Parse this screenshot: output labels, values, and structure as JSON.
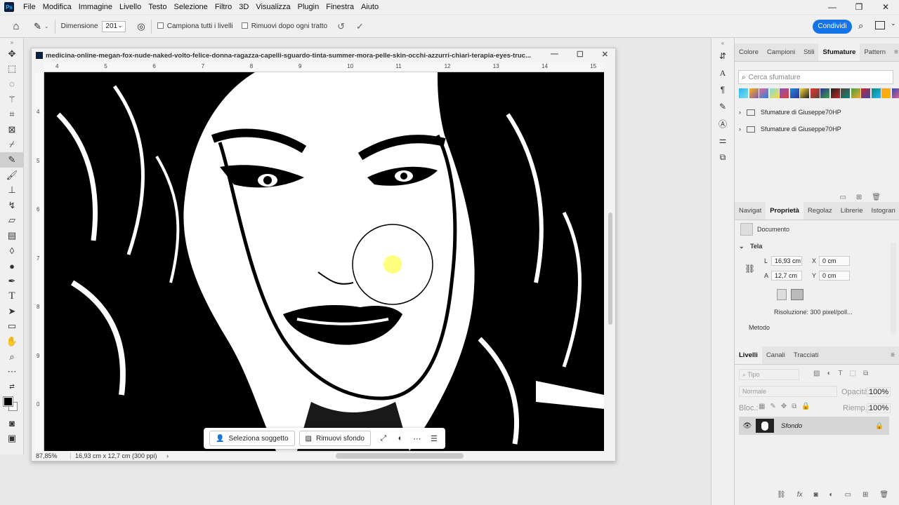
{
  "app": {
    "menu": [
      "File",
      "Modifica",
      "Immagine",
      "Livello",
      "Testo",
      "Selezione",
      "Filtro",
      "3D",
      "Visualizza",
      "Plugin",
      "Finestra",
      "Aiuto"
    ],
    "logo": "Ps",
    "window_controls": [
      "—",
      "❐",
      "✕"
    ]
  },
  "options_bar": {
    "size_label": "Dimensione",
    "size_value": "201",
    "sample_all_layers": "Campiona tutti i livelli",
    "remove_after_stroke": "Rimuovi dopo ogni tratto",
    "share_label": "Condividi"
  },
  "document": {
    "title": "medicina-online-megan-fox-nude-naked-volto-felice-donna-ragazza-capelli-sguardo-tinta-summer-mora-pelle-skin-occhi-azzurri-chiari-terapia-eyes-truc...",
    "ruler_top": [
      "4",
      "5",
      "6",
      "7",
      "8",
      "9",
      "10",
      "11",
      "12",
      "13",
      "14",
      "15"
    ],
    "ruler_left": [
      "4",
      "5",
      "6",
      "7",
      "8",
      "9",
      "0"
    ],
    "zoom": "87,85%",
    "doc_size": "16,93 cm x 12,7 cm (300 ppi)",
    "status_arrow": "›"
  },
  "taskbar": {
    "select_subject": "Seleziona soggetto",
    "remove_bg": "Rimuovi sfondo"
  },
  "gradients_panel": {
    "tabs": [
      "Colore",
      "Campioni",
      "Stili",
      "Sfumature",
      "Pattern"
    ],
    "active_tab": "Sfumature",
    "search_placeholder": "Cerca sfumature",
    "folders": [
      "Sfumature di Giuseppe70HP",
      "Sfumature di Giuseppe70HP"
    ],
    "swatch_colors": [
      "#29b6f6",
      "#ffb300",
      "#f06292",
      "#80deea",
      "#7e57c2",
      "#1e88e5",
      "#fdd835",
      "#e53935",
      "#283593",
      "#212121",
      "#5d4037",
      "#43a047",
      "#c62828",
      "#00897b",
      "#f9a825",
      "#3949ab"
    ]
  },
  "properties_panel": {
    "tabs": [
      "Navigat",
      "Proprietà",
      "Regolaz",
      "Librerie",
      "Istogran"
    ],
    "active_tab": "Proprietà",
    "doc_label": "Documento",
    "section": "Tela",
    "L_label": "L",
    "L_value": "16,93 cm",
    "A_label": "A",
    "A_value": "12,7 cm",
    "X_label": "X",
    "X_value": "0 cm",
    "Y_label": "Y",
    "Y_value": "0 cm",
    "resolution": "Risoluzione: 300 pixel/poll...",
    "method": "Metodo"
  },
  "layers_panel": {
    "tabs": [
      "Livelli",
      "Canali",
      "Tracciati"
    ],
    "active_tab": "Livelli",
    "filter_placeholder": "Tipo",
    "blend_mode": "Normale",
    "opacity_label": "Opacità:",
    "opacity_value": "100%",
    "lock_label": "Bloc.:",
    "fill_label": "Riemp.:",
    "fill_value": "100%",
    "layer_name": "Sfondo"
  }
}
